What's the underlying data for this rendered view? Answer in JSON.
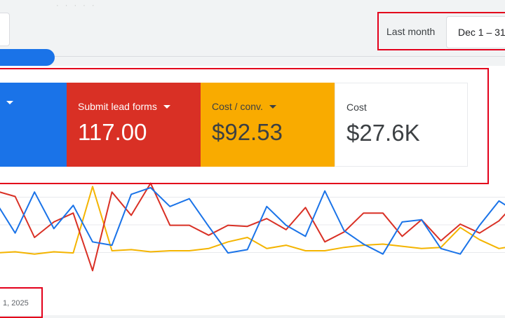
{
  "header": {
    "date_preset": "Last month",
    "date_range": "Dec 1 – 31"
  },
  "metrics": [
    {
      "label": "",
      "value": "",
      "color": "#1a73e8",
      "has_dropdown": true
    },
    {
      "label": "Submit lead forms",
      "value": "117.00",
      "color": "#d93025",
      "has_dropdown": true
    },
    {
      "label": "Cost / conv.",
      "value": "$92.53",
      "color": "#f9ab00",
      "has_dropdown": true
    },
    {
      "label": "Cost",
      "value": "$27.6K",
      "color": "#ffffff",
      "has_dropdown": false
    }
  ],
  "chart": {
    "x_axis_label": "1, 2025",
    "colors": {
      "blue": "#1a73e8",
      "red": "#d93025",
      "yellow": "#f4b400"
    }
  },
  "chart_data": {
    "type": "line",
    "x": [
      0,
      1,
      2,
      3,
      4,
      5,
      6,
      7,
      8,
      9,
      10,
      11,
      12,
      13,
      14,
      15,
      16,
      17,
      18,
      19,
      20,
      21,
      22,
      23,
      24,
      25,
      26,
      27
    ],
    "series": [
      {
        "values": [
          82,
          54,
          91,
          58,
          79,
          46,
          43,
          89,
          95,
          78,
          85,
          60,
          36,
          39,
          78,
          61,
          51,
          92,
          56,
          44,
          35,
          64,
          66,
          40,
          35,
          61,
          83,
          72
        ]
      },
      {
        "values": [
          92,
          87,
          50,
          64,
          72,
          20,
          91,
          70,
          99,
          61,
          61,
          52,
          61,
          60,
          67,
          57,
          77,
          46,
          55,
          72,
          72,
          51,
          66,
          47,
          62,
          54,
          65,
          84
        ]
      },
      {
        "values": [
          36,
          37,
          35,
          37,
          36,
          96,
          38,
          39,
          37,
          38,
          38,
          40,
          46,
          50,
          40,
          43,
          38,
          38,
          41,
          43,
          44,
          42,
          40,
          41,
          59,
          48,
          40,
          43
        ]
      }
    ]
  }
}
